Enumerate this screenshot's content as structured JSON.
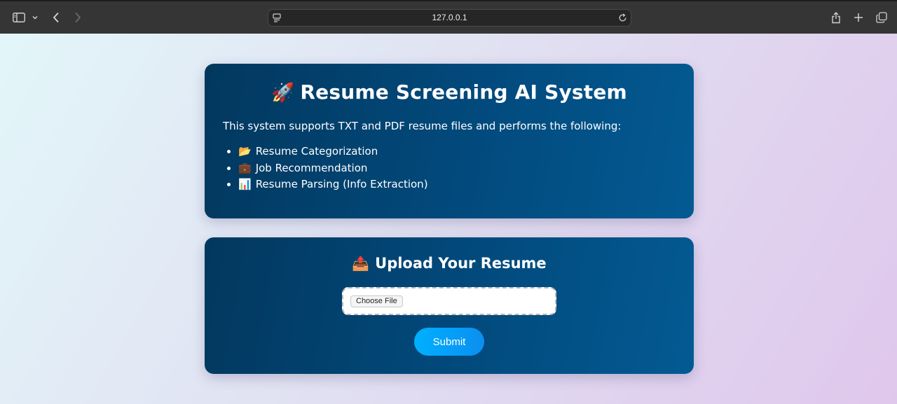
{
  "browser": {
    "url": "127.0.0.1"
  },
  "intro": {
    "title_emoji": "🚀",
    "title": "Resume Screening AI System",
    "description": "This system supports TXT and PDF resume files and performs the following:",
    "features": [
      {
        "emoji": "📂",
        "label": "Resume Categorization"
      },
      {
        "emoji": "💼",
        "label": "Job Recommendation"
      },
      {
        "emoji": "📊",
        "label": "Resume Parsing (Info Extraction)"
      }
    ]
  },
  "upload": {
    "title_emoji": "📤",
    "title": "Upload Your Resume",
    "choose_file_label": "Choose File",
    "submit_label": "Submit"
  },
  "colors": {
    "card_bg": "#024a7d",
    "submit_bg": "#00b0ff",
    "page_bg_start": "#e2f6f9",
    "page_bg_end": "#dfc7ec"
  }
}
